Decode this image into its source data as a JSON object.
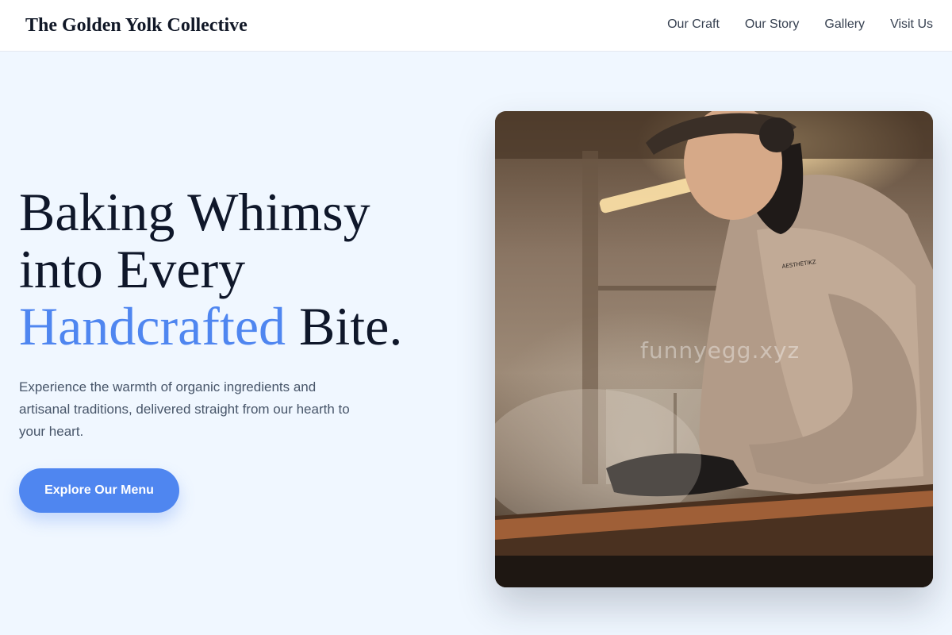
{
  "header": {
    "brand": "The Golden Yolk Collective",
    "nav": [
      "Our Craft",
      "Our Story",
      "Gallery",
      "Visit Us"
    ]
  },
  "hero": {
    "headline_line1": "Baking Whimsy",
    "headline_line2": "into Every",
    "headline_accent": "Handcrafted",
    "headline_end": "Bite.",
    "subtitle": "Experience the warmth of organic ingredients and artisanal traditions, delivered straight from our hearth to your heart.",
    "cta_label": "Explore Our Menu"
  },
  "image": {
    "watermark": "funnyegg.xyz",
    "shirt_print": "AESTHETIKZ"
  },
  "colors": {
    "background": "#f0f7ff",
    "accent": "#4f86f0",
    "heading": "#0f172a",
    "body_text": "#475569",
    "nav_text": "#374151"
  }
}
